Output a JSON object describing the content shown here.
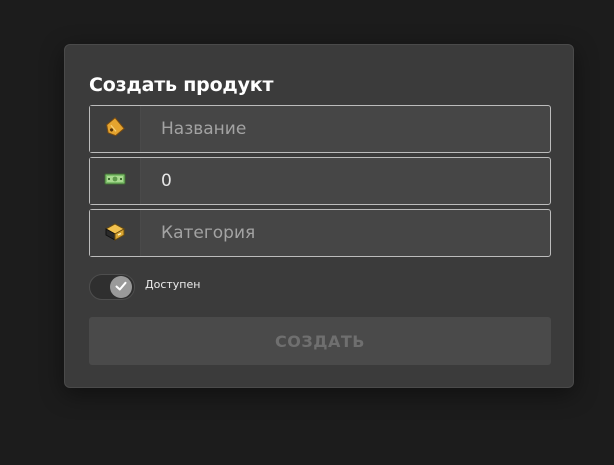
{
  "form": {
    "title": "Создать продукт",
    "fields": [
      {
        "icon": "price-tag-icon",
        "placeholder": "Название",
        "value": ""
      },
      {
        "icon": "banknote-icon",
        "placeholder": "",
        "value": "0"
      },
      {
        "icon": "box-icon",
        "placeholder": "Категория",
        "value": ""
      }
    ],
    "available_toggle": {
      "label": "Доступен",
      "checked": true
    },
    "submit_label": "СОЗДАТЬ"
  },
  "colors": {
    "background": "#1c1c1c",
    "card": "#3b3b3b",
    "field_border": "#bcbcbc",
    "button_disabled_bg": "#4a4a4a",
    "button_disabled_text": "#6f6f6f"
  }
}
